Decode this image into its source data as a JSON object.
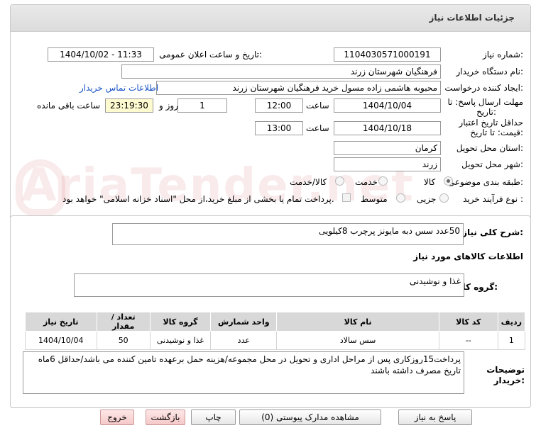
{
  "header": {
    "title": "جزئیات اطلاعات نیاز"
  },
  "form": {
    "need_number_label": "شماره نیاز:",
    "need_number": "1104030571000191",
    "announce_label": "تاریخ و ساعت اعلان عمومی:",
    "announce_value": "1404/10/02 - 11:33",
    "buyer_org_label": "نام دستگاه خریدار:",
    "buyer_org": "فرهنگیان شهرستان زرند",
    "creator_label": "ایجاد کننده درخواست:",
    "creator": "محبوبه هاشمی زاده مسول خرید فرهنگیان شهرستان زرند",
    "contact_link": "اطلاعات تماس خریدار",
    "deadline_label_1": "مهلت ارسال پاسخ: تا",
    "deadline_label_2": "تاریخ:",
    "deadline_date": "1404/10/04",
    "time_label": "ساعت",
    "deadline_time": "12:00",
    "days_value": "1",
    "days_label": "روز و",
    "remaining_time": "23:19:30",
    "remaining_label": "ساعت باقی مانده",
    "validity_label_1": "حداقل تاریخ اعتبار",
    "validity_label_2": "قیمت: تا تاریخ:",
    "validity_date": "1404/10/18",
    "validity_time": "13:00",
    "province_label": "استان محل تحویل:",
    "province": "کرمان",
    "city_label": "شهر محل تحویل:",
    "city": "زرند",
    "category_label": "طبقه بندی موضوعی:",
    "category_options": [
      "کالا",
      "خدمت",
      "کالا/خدمت"
    ],
    "process_label": "نوع فرآیند خرید :",
    "process_options": [
      "جزیی",
      "متوسط"
    ],
    "payment_note": "پرداخت تمام یا بخشی از مبلغ خرید،از محل \"اسناد خزانه اسلامی\" خواهد بود."
  },
  "summary": {
    "label": "شرح کلی نیاز:",
    "value": "50عدد سس دبه مایونز پرچرب 8کیلویی"
  },
  "goods_info": {
    "title": "اطلاعات کالاهای مورد نیاز",
    "group_label": "گروه کالا:",
    "group_value": "غذا و نوشیدنی"
  },
  "table": {
    "headers": [
      "ردیف",
      "کد کالا",
      "نام کالا",
      "واحد شمارش",
      "گروه کالا",
      "تعداد / مقدار",
      "تاریخ نیاز"
    ],
    "rows": [
      [
        "1",
        "--",
        "سس سالاد",
        "عدد",
        "غذا و نوشیدنی",
        "50",
        "1404/10/04"
      ]
    ]
  },
  "buyer_notes": {
    "label_1": "توضیحات",
    "label_2": "خریدار:",
    "value": "پرداخت15روزکاری پس از مراحل اداری و تحویل در محل مجموعه/هزینه حمل برعهده تامین کننده می باشد/حداقل  6ماه تاریخ مصرف داشته باشند"
  },
  "buttons": {
    "reply": "پاسخ به نیاز",
    "view_docs": "مشاهده مدارک پیوستی (0)",
    "print": "چاپ",
    "back": "بازگشت",
    "exit": "خروج"
  }
}
